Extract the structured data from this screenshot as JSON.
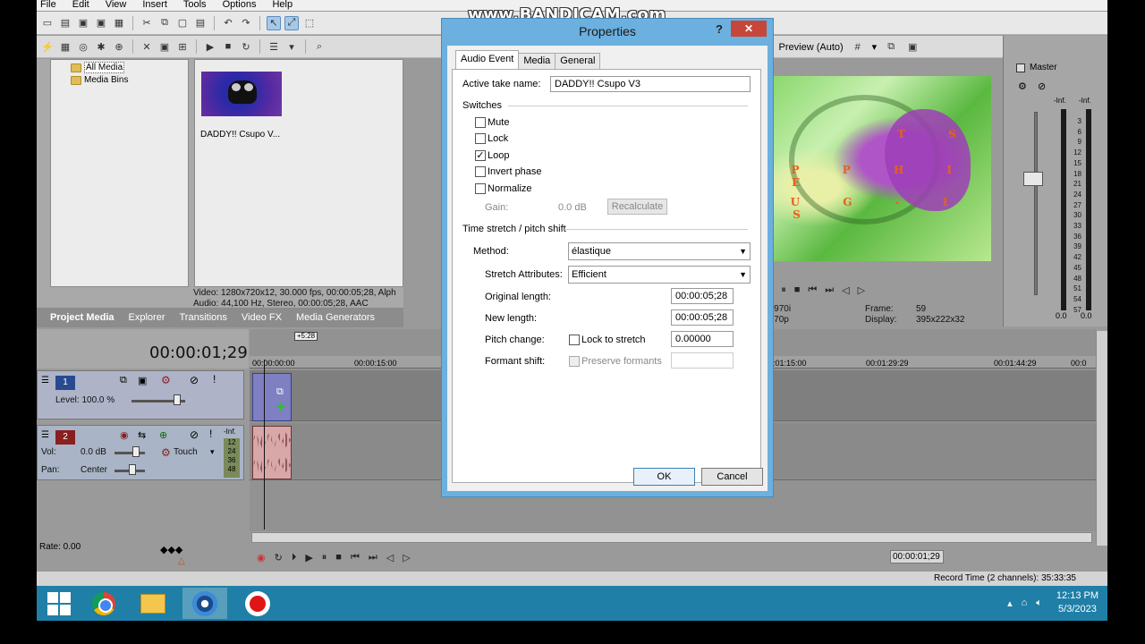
{
  "menu": [
    "File",
    "Edit",
    "View",
    "Insert",
    "Tools",
    "Options",
    "Help"
  ],
  "watermark": "www.BANDICAM.com",
  "project_media": {
    "tree": {
      "all_media": "All Media",
      "media_bins": "Media Bins"
    },
    "thumbnail_label": "DADDY!! Csupo V...",
    "info_video": "Video: 1280x720x12, 30.000 fps, 00:00:05;28, Alph",
    "info_audio": "Audio: 44,100 Hz, Stereo, 00:00:05;28, AAC",
    "tabs": [
      "Project Media",
      "Explorer",
      "Transitions",
      "Video FX",
      "Media Generators"
    ]
  },
  "preview": {
    "mode": "Preview (Auto)",
    "overlay_lines": [
      "T S",
      "A P P H I R E",
      "L U G - I N S"
    ],
    "info_left_1": "0x32, 29.970i",
    "info_left_2": "x32, 29.970p",
    "frame_label": "Frame:",
    "frame_value": "59",
    "display_label": "Display:",
    "display_value": "395x222x32"
  },
  "master": {
    "title": "Master",
    "left_inf": "-Inf.",
    "right_inf": "-Inf.",
    "scale": [
      "3",
      "6",
      "9",
      "12",
      "15",
      "18",
      "21",
      "24",
      "27",
      "30",
      "33",
      "36",
      "39",
      "42",
      "45",
      "48",
      "51",
      "54",
      "57"
    ],
    "left_db": "0.0",
    "right_db": "0.0"
  },
  "timeline": {
    "timecode": "00:00:01;29",
    "region_label": "+5:28",
    "ruler": [
      "00:00:00:00",
      "00:00:15:00",
      "00:01:15:00",
      "00:01:29:29",
      "00:01:44:29",
      "00:0"
    ],
    "track1": {
      "number": "1",
      "level": "Level: 100.0 %"
    },
    "track2": {
      "number": "2",
      "inf": "-Inf.",
      "vol_label": "Vol:",
      "vol_value": "0.0 dB",
      "touch": "Touch",
      "pan_label": "Pan:",
      "pan_value": "Center",
      "meter": [
        "12",
        "24",
        "36",
        "48"
      ]
    },
    "rate": "Rate: 0.00",
    "cursor_time": "00:00:01;29",
    "record_time": "Record Time (2 channels): 35:33:35"
  },
  "dialog": {
    "title": "Properties",
    "help": "?",
    "close": "✕",
    "tabs": [
      "Audio Event",
      "Media",
      "General"
    ],
    "active_take_label": "Active take name:",
    "active_take_value": "DADDY!! Csupo V3",
    "switches_label": "Switches",
    "switches": [
      {
        "label": "Mute",
        "checked": false
      },
      {
        "label": "Lock",
        "checked": false
      },
      {
        "label": "Loop",
        "checked": true
      },
      {
        "label": "Invert phase",
        "checked": false
      },
      {
        "label": "Normalize",
        "checked": false
      }
    ],
    "gain_label": "Gain:",
    "gain_value": "0.0 dB",
    "recalculate": "Recalculate",
    "stretch_label": "Time stretch / pitch shift",
    "method_label": "Method:",
    "method_value": "élastique",
    "stretch_attr_label": "Stretch Attributes:",
    "stretch_attr_value": "Efficient",
    "orig_length_label": "Original length:",
    "orig_length_value": "00:00:05;28",
    "new_length_label": "New length:",
    "new_length_value": "00:00:05;28",
    "pitch_label": "Pitch change:",
    "lock_stretch_label": "Lock to stretch",
    "pitch_value": "0.00000",
    "formant_label": "Formant shift:",
    "preserve_formants_label": "Preserve formants",
    "ok": "OK",
    "cancel": "Cancel"
  },
  "taskbar": {
    "time": "12:13 PM",
    "date": "5/3/2023"
  }
}
